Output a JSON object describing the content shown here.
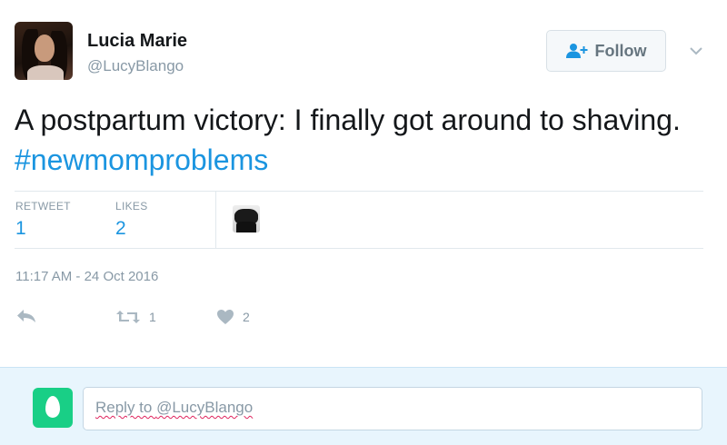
{
  "user": {
    "display_name": "Lucia Marie",
    "screen_name": "@LucyBlango"
  },
  "follow_button": {
    "label": "Follow"
  },
  "tweet": {
    "text": "A postpartum victory: I finally got around to shaving. ",
    "hashtag": "#newmomproblems",
    "timestamp": "11:17 AM - 24 Oct 2016"
  },
  "stats": {
    "retweet_label": "RETWEET",
    "retweet_count": "1",
    "likes_label": "LIKES",
    "likes_count": "2"
  },
  "actions": {
    "reply_icon": "reply-icon",
    "retweet_icon": "retweet-icon",
    "retweet_count": "1",
    "like_icon": "heart-icon",
    "like_count": "2"
  },
  "reply": {
    "prefix": "Reply to ",
    "handle": "@LucyBlango"
  },
  "colors": {
    "link": "#1b95e0",
    "muted": "#8899a6",
    "reply_bg": "#e8f5fd",
    "egg_green": "#19cf86"
  }
}
